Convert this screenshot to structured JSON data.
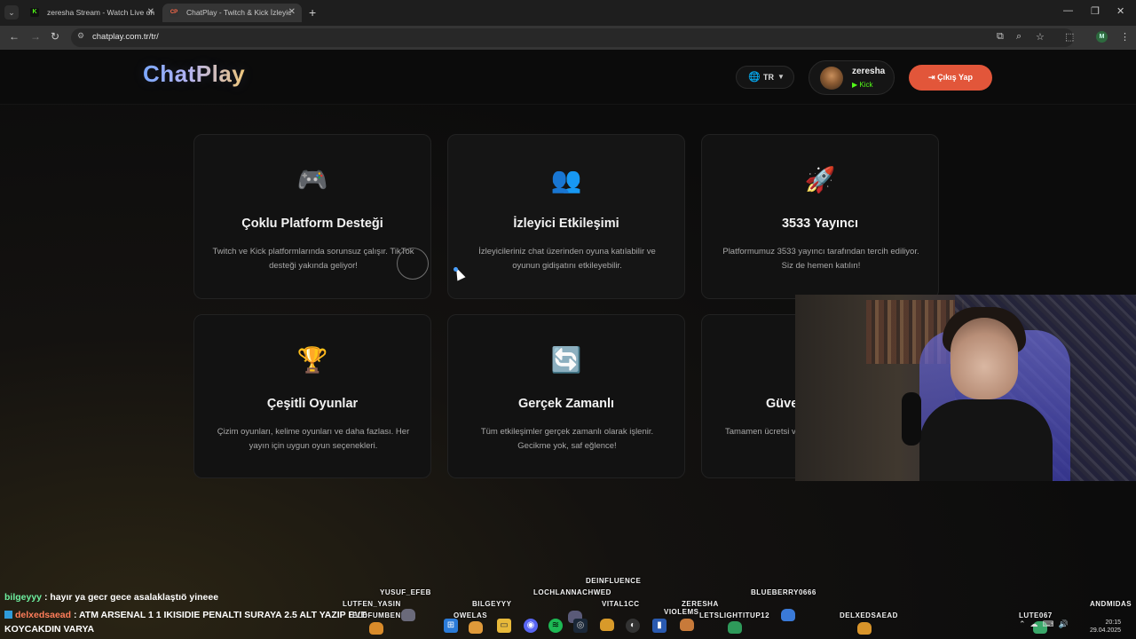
{
  "browser": {
    "tabs": [
      {
        "label": "zeresha Stream - Watch Live on",
        "favicon": "K"
      },
      {
        "label": "ChatPlay - Twitch & Kick İzleyic",
        "favicon": "CP"
      }
    ],
    "url": "chatplay.com.tr/tr/",
    "profile_initial": "M"
  },
  "header": {
    "logo": "ChatPlay",
    "language": "TR",
    "user": {
      "name": "zeresha",
      "platform": "Kick"
    },
    "logout_label": "Çıkış Yap"
  },
  "cards": [
    {
      "icon": "gamepad-icon",
      "glyph": "🎮",
      "title": "Çoklu Platform Desteği",
      "desc": "Twitch ve Kick platformlarında sorunsuz çalışır. TikTok desteği yakında geliyor!"
    },
    {
      "icon": "users-icon",
      "glyph": "👥",
      "title": "İzleyici Etkileşimi",
      "desc": "İzleyicileriniz chat üzerinden oyuna katılabilir ve oyunun gidişatını etkileyebilir."
    },
    {
      "icon": "rocket-icon",
      "glyph": "🚀",
      "title": "3533 Yayıncı",
      "desc": "Platformumuz 3533 yayıncı tarafından tercih ediliyor. Siz de hemen katılın!"
    },
    {
      "icon": "trophy-icon",
      "glyph": "🏆",
      "title": "Çeşitli Oyunlar",
      "desc": "Çizim oyunları, kelime oyunları ve daha fazlası. Her yayın için uygun oyun seçenekleri."
    },
    {
      "icon": "sync-icon",
      "glyph": "🔄",
      "title": "Gerçek Zamanlı",
      "desc": "Tüm etkileşimler gerçek zamanlı olarak işlenir. Gecikme yok, saf eğlence!"
    },
    {
      "icon": "shield-icon",
      "glyph": "",
      "title": "Güve",
      "desc": "Tamamen ücretsi ve gizliliği"
    }
  ],
  "chat": [
    {
      "user": "bilgeyyy",
      "message": "hayır ya gecr gece asalaklaştıö yineee"
    },
    {
      "user": "delxedsaead",
      "message": "ATM ARSENAL 1 1 IKISIDIE PENALTI SURAYA 2.5 ALT YAZIP EVE",
      "continuation": "KOYCAKDIN VARYA"
    }
  ],
  "viewers": [
    "YUSUF_EFEB",
    "LUTFEN_YASIN",
    "ELDFUMBENN",
    "OWELAS",
    "BILGEYYY",
    "LOCHLANNACHWED",
    "DEINFLUENCE",
    "VITAL1CC",
    "ZERESHA",
    "VIOLEMS",
    "LETSLIGHTITUP12",
    "BLUEBERRY0666",
    "DELXEDSAEAD",
    "LUTE067",
    "ANDMIDAS"
  ],
  "clock": {
    "time": "20:15",
    "date": "29.04.2025"
  }
}
